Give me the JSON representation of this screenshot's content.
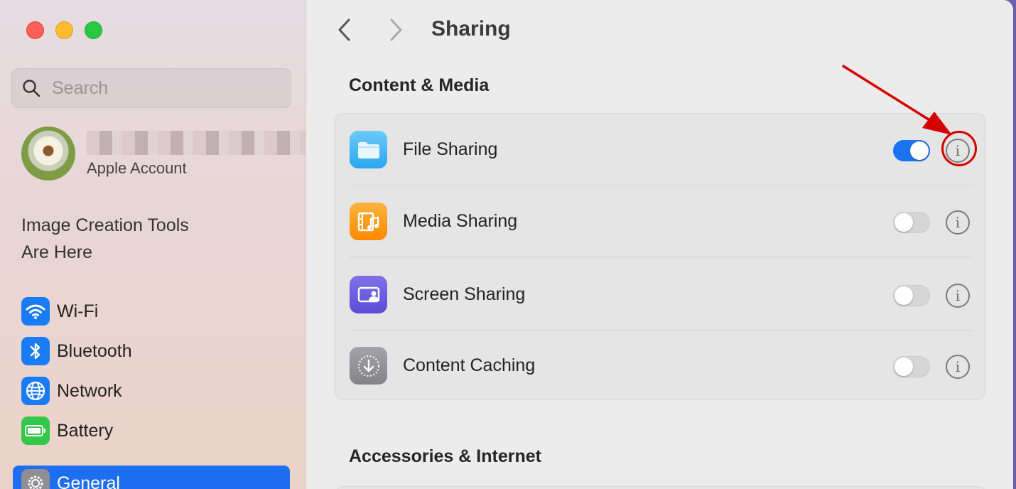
{
  "window": {
    "traffic_lights": {
      "close_color": "#fe5f57",
      "minimize_color": "#febc2e",
      "zoom_color": "#28c840"
    }
  },
  "sidebar": {
    "search": {
      "placeholder": "Search",
      "icon": "magnifying-glass-icon"
    },
    "account": {
      "subtitle": "Apple Account"
    },
    "promo": {
      "line1": "Image Creation Tools",
      "line2": "Are Here"
    },
    "items": [
      {
        "label": "Wi-Fi",
        "icon": "wifi-icon",
        "color": "#1a7cf5"
      },
      {
        "label": "Bluetooth",
        "icon": "bluetooth-icon",
        "color": "#1a7cf5"
      },
      {
        "label": "Network",
        "icon": "globe-icon",
        "color": "#1a7cf5"
      },
      {
        "label": "Battery",
        "icon": "battery-icon",
        "color": "#34c84a"
      },
      {
        "label": "General",
        "icon": "gear-icon",
        "color": "#8e8e93",
        "selected": true
      }
    ]
  },
  "main": {
    "title": "Sharing",
    "sections": [
      {
        "title": "Content & Media",
        "rows": [
          {
            "label": "File Sharing",
            "icon": "folder-icon",
            "enabled": true
          },
          {
            "label": "Media Sharing",
            "icon": "media-icon",
            "enabled": false
          },
          {
            "label": "Screen Sharing",
            "icon": "screen-sharing-icon",
            "enabled": false
          },
          {
            "label": "Content Caching",
            "icon": "content-caching-icon",
            "enabled": false
          }
        ]
      },
      {
        "title": "Accessories & Internet"
      }
    ]
  },
  "annotation": {
    "color": "#d40000",
    "target": "File Sharing info button"
  }
}
